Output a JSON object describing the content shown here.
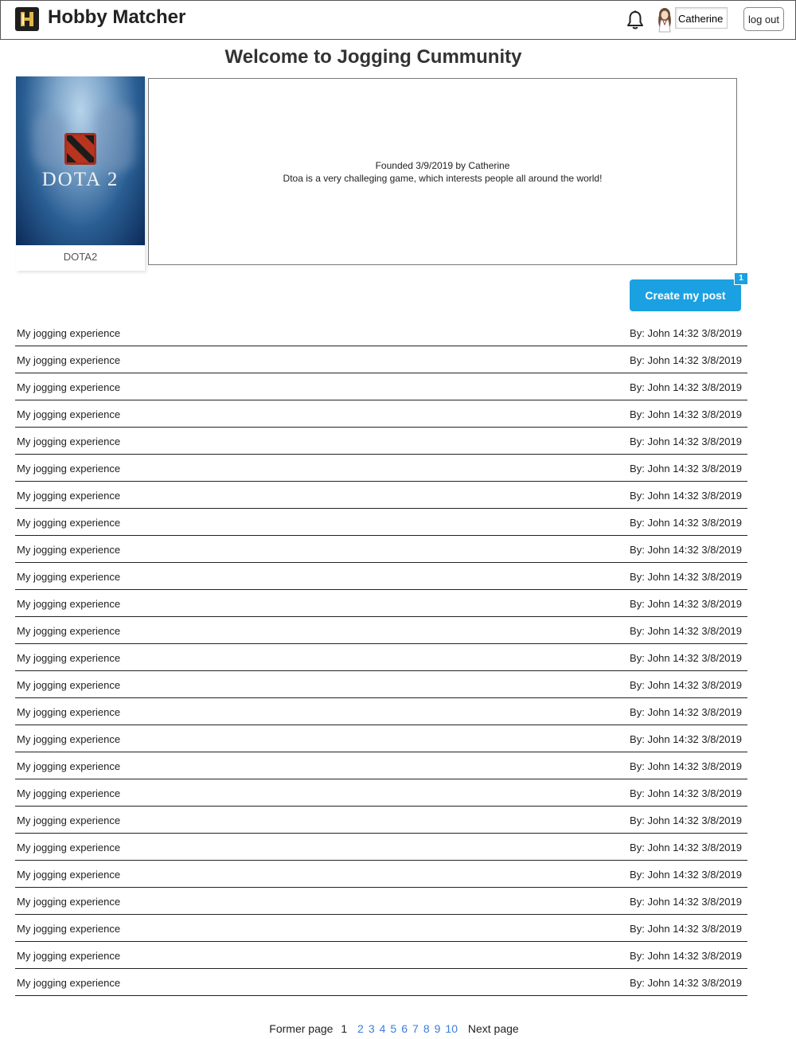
{
  "header": {
    "app_title": "Hobby Matcher",
    "username": "Catherine",
    "logout_label": "log out"
  },
  "page": {
    "welcome": "Welcome to Jogging Cummunity"
  },
  "community_card": {
    "cover_text": "DOTA 2",
    "label": "DOTA2"
  },
  "description": {
    "founded": "Founded 3/9/2019 by Catherine",
    "text": "Dtoa is a very challeging game, which interests people all around the world!"
  },
  "create_post": {
    "label": "Create my post",
    "badge": "1"
  },
  "posts": [
    {
      "title": "My jogging experience",
      "meta": "By: John 14:32 3/8/2019"
    },
    {
      "title": "My jogging experience",
      "meta": "By: John 14:32 3/8/2019"
    },
    {
      "title": "My jogging experience",
      "meta": "By: John 14:32 3/8/2019"
    },
    {
      "title": "My jogging experience",
      "meta": "By: John 14:32 3/8/2019"
    },
    {
      "title": "My jogging experience",
      "meta": "By: John 14:32 3/8/2019"
    },
    {
      "title": "My jogging experience",
      "meta": "By: John 14:32 3/8/2019"
    },
    {
      "title": "My jogging experience",
      "meta": "By: John 14:32 3/8/2019"
    },
    {
      "title": "My jogging experience",
      "meta": "By: John 14:32 3/8/2019"
    },
    {
      "title": "My jogging experience",
      "meta": "By: John 14:32 3/8/2019"
    },
    {
      "title": "My jogging experience",
      "meta": "By: John 14:32 3/8/2019"
    },
    {
      "title": "My jogging experience",
      "meta": "By: John 14:32 3/8/2019"
    },
    {
      "title": "My jogging experience",
      "meta": "By: John 14:32 3/8/2019"
    },
    {
      "title": "My jogging experience",
      "meta": "By: John 14:32 3/8/2019"
    },
    {
      "title": "My jogging experience",
      "meta": "By: John 14:32 3/8/2019"
    },
    {
      "title": "My jogging experience",
      "meta": "By: John 14:32 3/8/2019"
    },
    {
      "title": "My jogging experience",
      "meta": "By: John 14:32 3/8/2019"
    },
    {
      "title": "My jogging experience",
      "meta": "By: John 14:32 3/8/2019"
    },
    {
      "title": "My jogging experience",
      "meta": "By: John 14:32 3/8/2019"
    },
    {
      "title": "My jogging experience",
      "meta": "By: John 14:32 3/8/2019"
    },
    {
      "title": "My jogging experience",
      "meta": "By: John 14:32 3/8/2019"
    },
    {
      "title": "My jogging experience",
      "meta": "By: John 14:32 3/8/2019"
    },
    {
      "title": "My jogging experience",
      "meta": "By: John 14:32 3/8/2019"
    },
    {
      "title": "My jogging experience",
      "meta": "By: John 14:32 3/8/2019"
    },
    {
      "title": "My jogging experience",
      "meta": "By: John 14:32 3/8/2019"
    },
    {
      "title": "My jogging experience",
      "meta": "By: John 14:32 3/8/2019"
    }
  ],
  "pagination": {
    "former_label": "Former page",
    "current_page": "1",
    "pages": [
      "2",
      "3",
      "4",
      "5",
      "6",
      "7",
      "8",
      "9",
      "10"
    ],
    "next_label": "Next page"
  },
  "icons": {
    "logo": "hobby-matcher-logo-icon",
    "bell": "bell-icon",
    "avatar": "user-avatar"
  },
  "colors": {
    "accent": "#1ba1e2",
    "link": "#3b7dd8"
  }
}
